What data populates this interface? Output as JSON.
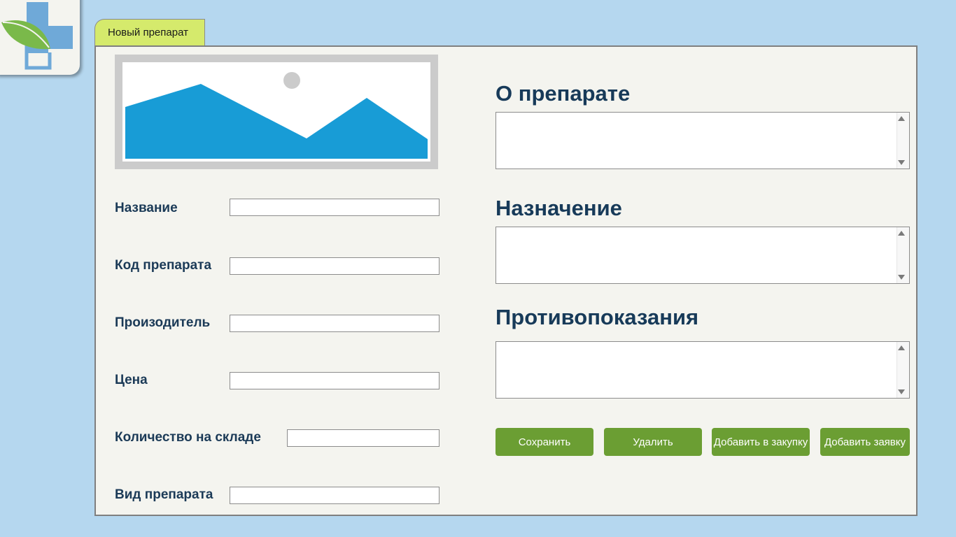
{
  "tab": {
    "label": "Новый препарат"
  },
  "form": {
    "fields": [
      {
        "label": "Название",
        "value": ""
      },
      {
        "label": "Код препарата",
        "value": ""
      },
      {
        "label": "Произодитель",
        "value": ""
      },
      {
        "label": "Цена",
        "value": ""
      },
      {
        "label": "Количество на складе",
        "value": ""
      },
      {
        "label": "Вид препарата",
        "value": ""
      }
    ]
  },
  "sections": {
    "about": {
      "title": "О препарате",
      "value": ""
    },
    "purpose": {
      "title": "Назначение",
      "value": ""
    },
    "contraindications": {
      "title": "Противопоказания",
      "value": ""
    }
  },
  "buttons": {
    "save": "Сохранить",
    "delete": "Удалить",
    "add_purchase": "Добавить в закупку",
    "add_request": "Добавить заявку"
  },
  "colors": {
    "background": "#b5d7ef",
    "panel": "#f4f4ef",
    "tab": "#d5ea6c",
    "heading": "#173a59",
    "button": "#6b9e33",
    "image_fill": "#189cd6"
  },
  "icons": {
    "logo": "medical-cross-leaf-logo",
    "image_placeholder": "image-placeholder-icon"
  }
}
